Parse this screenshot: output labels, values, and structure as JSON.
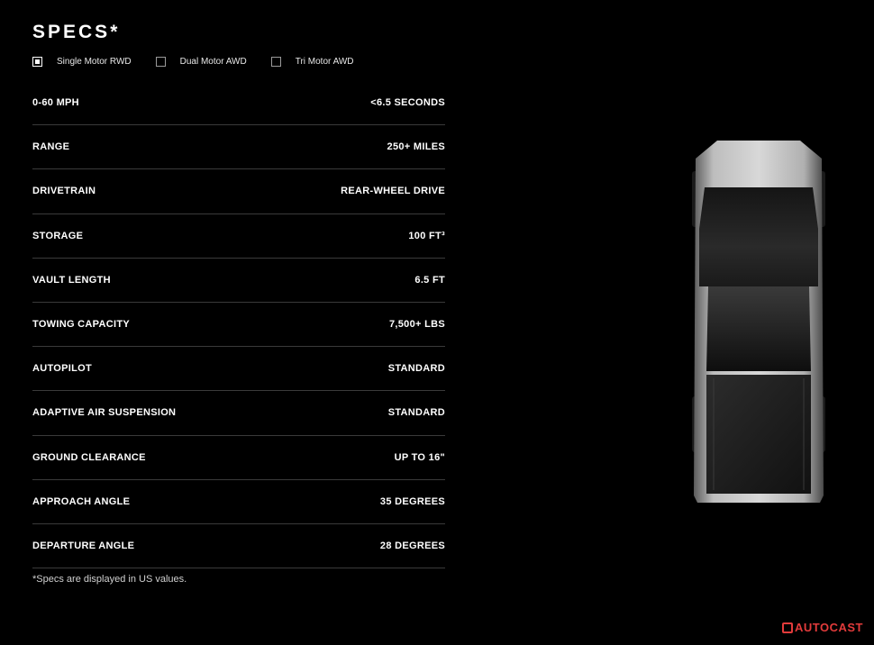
{
  "specs": {
    "title": "SPECS*",
    "options": [
      {
        "label": "Single Motor RWD",
        "checked": true
      },
      {
        "label": "Dual Motor AWD",
        "checked": false
      },
      {
        "label": "Tri Motor AWD",
        "checked": false
      }
    ],
    "rows": [
      {
        "label": "0-60 MPH",
        "value": "<6.5 SECONDS"
      },
      {
        "label": "RANGE",
        "value": "250+ MILES"
      },
      {
        "label": "DRIVETRAIN",
        "value": "REAR-WHEEL DRIVE"
      },
      {
        "label": "STORAGE",
        "value": "100 FT³"
      },
      {
        "label": "VAULT LENGTH",
        "value": "6.5 FT"
      },
      {
        "label": "TOWING CAPACITY",
        "value": "7,500+ LBS"
      },
      {
        "label": "AUTOPILOT",
        "value": "STANDARD"
      },
      {
        "label": "ADAPTIVE AIR SUSPENSION",
        "value": "STANDARD"
      },
      {
        "label": "GROUND CLEARANCE",
        "value": "UP TO 16\""
      },
      {
        "label": "APPROACH ANGLE",
        "value": "35 DEGREES"
      },
      {
        "label": "DEPARTURE ANGLE",
        "value": "28 DEGREES"
      }
    ],
    "footnote": "*Specs are displayed in US values."
  },
  "watermark": {
    "text": "AUTOCAST",
    "color": "#e23b3b"
  },
  "colors": {
    "background": "#000000",
    "text": "#ffffff",
    "divider": "#3a3a3a"
  }
}
